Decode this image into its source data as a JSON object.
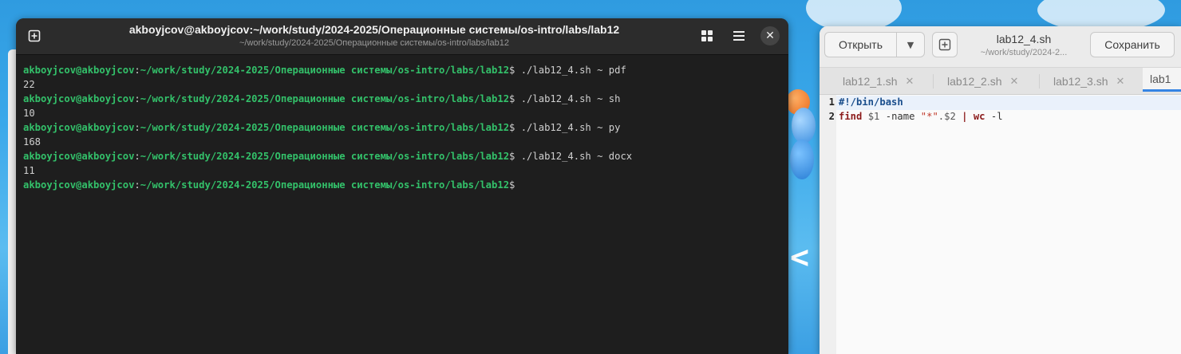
{
  "terminal": {
    "title": "akboyjcov@akboyjcov:~/work/study/2024-2025/Операционные системы/os-intro/labs/lab12",
    "subtitle": "~/work/study/2024-2025/Операционные системы/os-intro/labs/lab12",
    "prompt_user": "akboyjcov@akboyjcov",
    "prompt_path": "~/work/study/2024-2025/Операционные системы/os-intro/labs/lab12",
    "prompt_end": "$",
    "entries": [
      {
        "command": "./lab12_4.sh ~ pdf",
        "output": "22"
      },
      {
        "command": "./lab12_4.sh ~ sh",
        "output": "10"
      },
      {
        "command": "./lab12_4.sh ~ py",
        "output": "168"
      },
      {
        "command": "./lab12_4.sh ~ docx",
        "output": "11"
      }
    ]
  },
  "editor": {
    "open_label": "Открыть",
    "save_label": "Сохранить",
    "title": "lab12_4.sh",
    "subtitle": "~/work/study/2024-2...",
    "tabs": [
      {
        "label": "lab12_1.sh",
        "active": false
      },
      {
        "label": "lab12_2.sh",
        "active": false
      },
      {
        "label": "lab12_3.sh",
        "active": false
      },
      {
        "label": "lab1",
        "active": true
      }
    ],
    "lines": [
      {
        "number": "1",
        "shebang": "#!/bin/bash"
      },
      {
        "number": "2",
        "find": "find",
        "arg1": "$1",
        "name_opt": "-name",
        "pattern": "\"*\"",
        "ext": ".$2",
        "pipe": "|",
        "wc": "wc",
        "wc_opt": "-l"
      }
    ]
  },
  "icons": {
    "new_tab": "new-tab-icon",
    "grid": "grid-icon",
    "menu": "hamburger-menu-icon",
    "close": "close-icon",
    "dropdown": "chevron-down-icon",
    "new_document": "new-document-icon",
    "tab_close": "close-icon"
  },
  "colors": {
    "prompt": "#33c16a",
    "terminal_bg": "#1e1e1e",
    "accent": "#3584e4"
  }
}
